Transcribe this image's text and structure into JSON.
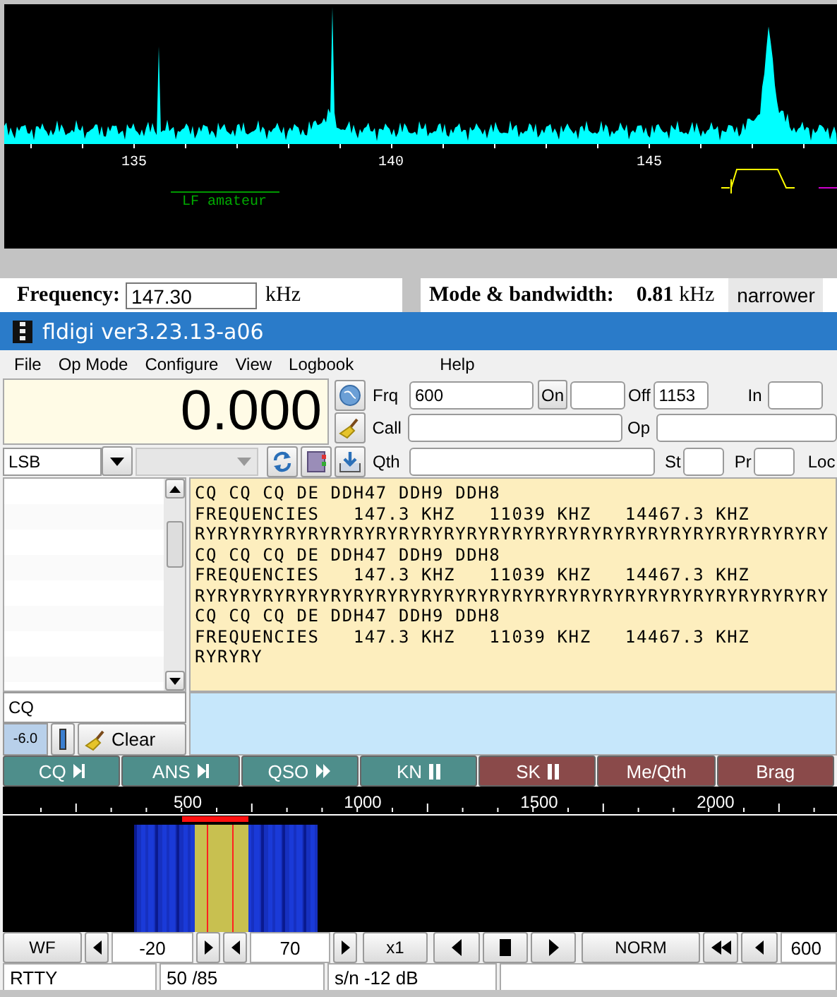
{
  "spectrum": {
    "axis_labels": [
      "135",
      "140",
      "145"
    ],
    "band_label": "LF amateur"
  },
  "tuning": {
    "frequency_label": "Frequency:",
    "frequency_value": "147.30",
    "frequency_unit": "kHz",
    "mode_label": "Mode & bandwidth:",
    "bandwidth_value": "0.81",
    "bandwidth_unit": "kHz",
    "narrower_button": "narrower"
  },
  "window": {
    "title": "fldigi ver3.23.13-a06"
  },
  "menu": [
    "File",
    "Op Mode",
    "Configure",
    "View",
    "Logbook",
    "Help"
  ],
  "rig": {
    "frequency_display": "0.000",
    "mode": "LSB",
    "frq_label": "Frq",
    "frq_value": "600",
    "on_button": "On",
    "off_label": "Off",
    "off_value": "1153",
    "in_label": "In",
    "call_label": "Call",
    "op_label": "Op",
    "qth_label": "Qth",
    "st_label": "St",
    "pr_label": "Pr",
    "loc_label": "Loc"
  },
  "receive_text": [
    "CQ CQ CQ DE DDH47 DDH9 DDH8",
    "FREQUENCIES   147.3 KHZ   11039 KHZ   14467.3 KHZ",
    "RYRYRYRYRYRYRYRYRYRYRYRYRYRYRYRYRYRYRYRYRYRYRYRYRYRYRYRY",
    "CQ CQ CQ DE DDH47 DDH9 DDH8",
    "FREQUENCIES   147.3 KHZ   11039 KHZ   14467.3 KHZ",
    "RYRYRYRYRYRYRYRYRYRYRYRYRYRYRYRYRYRYRYRYRYRYRYRYRYRYRYRY",
    "CQ CQ CQ DE DDH47 DDH9 DDH8",
    "FREQUENCIES   147.3 KHZ   11039 KHZ   14467.3 KHZ",
    "RYRYRY"
  ],
  "left_panel": {
    "entry": "CQ",
    "squelch_value": "-6.0",
    "clear_button": "Clear"
  },
  "macros": [
    {
      "label": "CQ",
      "kind": "end",
      "color": "#4e8e8b"
    },
    {
      "label": "ANS",
      "kind": "end",
      "color": "#4e8e8b"
    },
    {
      "label": "QSO",
      "kind": "forward",
      "color": "#4e8e8b"
    },
    {
      "label": "KN",
      "kind": "pause",
      "color": "#4e8e8b"
    },
    {
      "label": "SK",
      "kind": "pause",
      "color": "#8a4a4a"
    },
    {
      "label": "Me/Qth",
      "kind": "none",
      "color": "#8a4a4a"
    },
    {
      "label": "Brag",
      "kind": "none",
      "color": "#8a4a4a"
    }
  ],
  "waterfall": {
    "scale_labels": [
      "500",
      "1000",
      "1500",
      "2000"
    ]
  },
  "controls": {
    "wf_button": "WF",
    "min_value": "-20",
    "range_value": "70",
    "zoom_button": "x1",
    "speed_button": "NORM",
    "audio_frequency": "600"
  },
  "status_bar": [
    "RTTY",
    "50 /85",
    "s/n -12 dB"
  ]
}
